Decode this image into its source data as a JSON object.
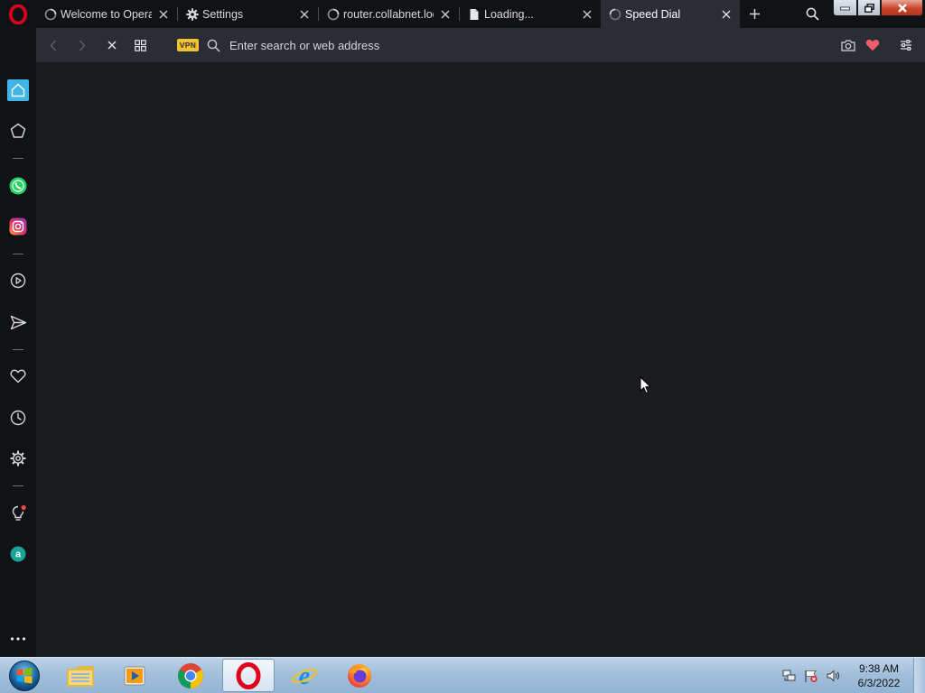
{
  "browser": {
    "tabs": [
      {
        "title": "Welcome to Opera",
        "icon": "loading-spinner-icon",
        "active": false
      },
      {
        "title": "Settings",
        "icon": "gear-icon",
        "active": false
      },
      {
        "title": "router.collabnet.loc",
        "icon": "loading-spinner-icon",
        "active": false
      },
      {
        "title": "Loading...",
        "icon": "document-icon",
        "active": false
      },
      {
        "title": "Speed Dial",
        "icon": "loading-spinner-icon",
        "active": true
      }
    ],
    "vpn_label": "VPN",
    "address_placeholder": "Enter search or web address",
    "accent_color": "#3fb5e8",
    "brand_color": "#e0001b"
  },
  "sidebar": {
    "items": [
      {
        "name": "home",
        "icon": "home-icon",
        "active": true
      },
      {
        "name": "pinboards",
        "icon": "star-icon"
      },
      {
        "name": "whatsapp",
        "icon": "whatsapp-icon"
      },
      {
        "name": "instagram",
        "icon": "instagram-icon"
      },
      {
        "name": "player",
        "icon": "play-icon"
      },
      {
        "name": "flow",
        "icon": "send-icon"
      },
      {
        "name": "bookmarks",
        "icon": "heart-icon"
      },
      {
        "name": "history",
        "icon": "clock-icon"
      },
      {
        "name": "settings",
        "icon": "gear-icon"
      },
      {
        "name": "tips",
        "icon": "lightbulb-icon"
      },
      {
        "name": "aria",
        "icon": "aria-icon"
      },
      {
        "name": "more",
        "icon": "more-icon"
      }
    ]
  },
  "taskbar": {
    "apps": [
      {
        "name": "Windows Explorer",
        "icon": "folder-icon"
      },
      {
        "name": "Media Player",
        "icon": "media-player-icon"
      },
      {
        "name": "Google Chrome",
        "icon": "chrome-icon"
      },
      {
        "name": "Opera",
        "icon": "opera-icon",
        "active": true
      },
      {
        "name": "Internet Explorer",
        "icon": "ie-icon"
      },
      {
        "name": "Firefox",
        "icon": "firefox-icon"
      }
    ],
    "tray": {
      "time": "9:38 AM",
      "date": "6/3/2022",
      "icons": [
        "network-icon",
        "action-center-icon",
        "volume-icon"
      ]
    }
  }
}
